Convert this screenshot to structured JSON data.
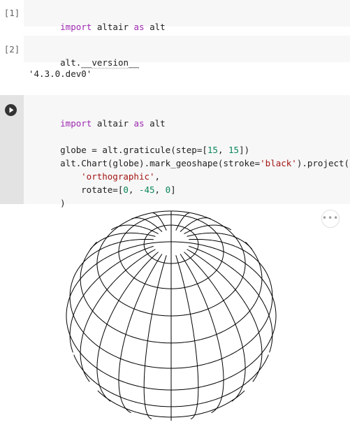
{
  "cells": [
    {
      "prompt": "[1]",
      "code": "import altair as alt"
    },
    {
      "prompt": "[2]",
      "code_prefix": "alt.",
      "code_attr": "__version__",
      "output": "'4.3.0.dev0'"
    },
    {
      "code_line1_kw1": "import",
      "code_line1_mid": " altair ",
      "code_line1_kw2": "as",
      "code_line1_end": " alt",
      "code_line3_a": "globe = alt.graticule(step=[",
      "code_line3_n1": "15",
      "code_line3_b": ", ",
      "code_line3_n2": "15",
      "code_line3_c": "])",
      "code_line4_a": "alt.Chart(globe).mark_geoshape(stroke=",
      "code_line4_str": "'black'",
      "code_line4_b": ").project(",
      "code_line5_str": "'orthographic'",
      "code_line5_b": ",",
      "code_line6_a": "rotate=[",
      "code_line6_n1": "0",
      "code_line6_b": ", ",
      "code_line6_n2": "-45",
      "code_line6_c": ", ",
      "code_line6_n3": "0",
      "code_line6_d": "]",
      "code_line7": ")"
    }
  ],
  "cell1_kw1": "import",
  "cell1_mid": " altair ",
  "cell1_kw2": "as",
  "cell1_end": " alt",
  "more_label": "•••",
  "icons": {
    "run": "play-icon",
    "more": "more-horizontal-icon"
  },
  "colors": {
    "keyword": "#9c27b0",
    "string": "#a31515",
    "number": "#098658",
    "code_bg": "#f7f7f7"
  },
  "chart_data": {
    "type": "geoshape",
    "projection": "orthographic",
    "graticule_step": [
      15,
      15
    ],
    "rotate": [
      0,
      -45,
      0
    ],
    "stroke": "black"
  }
}
